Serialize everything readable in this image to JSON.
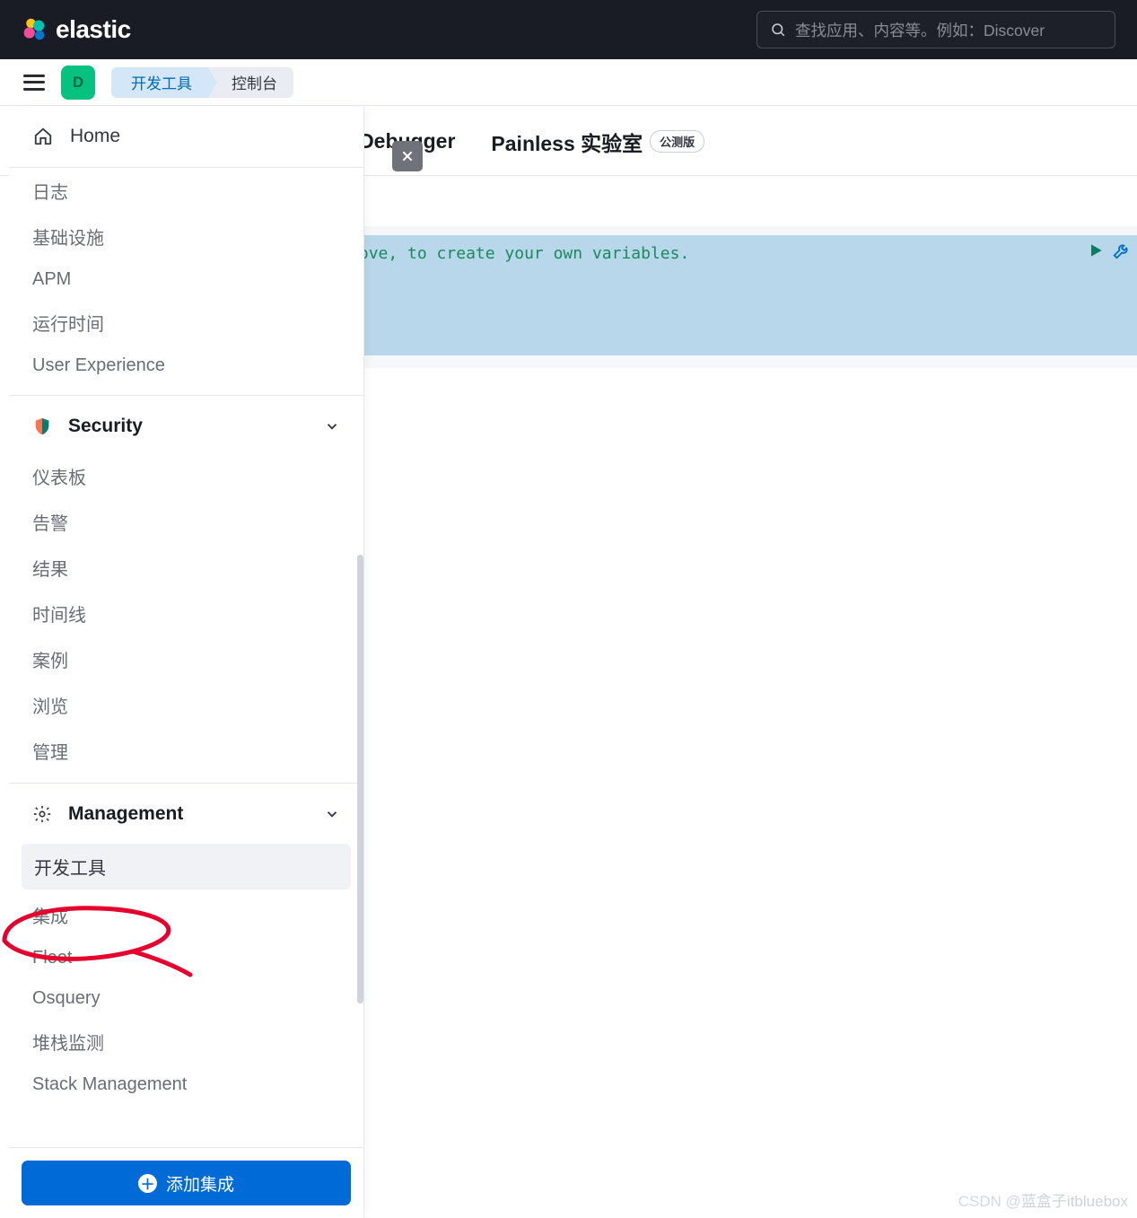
{
  "header": {
    "brand": "elastic",
    "search_placeholder": "查找应用、内容等。例如：Discover"
  },
  "avatar_letter": "D",
  "breadcrumbs": {
    "link_label": "开发工具",
    "current_label": "控制台"
  },
  "tabs": {
    "grok": "Grok Debugger",
    "painless": "Painless 实验室",
    "painless_badge": "公测版"
  },
  "editor": {
    "comment_fragment": "ton, above, to create your own variables.",
    "quote_fragment": "\""
  },
  "sidenav": {
    "home": "Home",
    "obs_items": [
      "日志",
      "基础设施",
      "APM",
      "运行时间",
      "User Experience"
    ],
    "security_header": "Security",
    "security_items": [
      "仪表板",
      "告警",
      "结果",
      "时间线",
      "案例",
      "浏览",
      "管理"
    ],
    "management_header": "Management",
    "management_items": [
      "开发工具",
      "集成",
      "Fleet",
      "Osquery",
      "堆栈监测",
      "Stack Management"
    ],
    "add_integration": "添加集成"
  },
  "watermark": {
    "text1": "CSDN @",
    "text2": "蓝盒子itbluebox"
  }
}
